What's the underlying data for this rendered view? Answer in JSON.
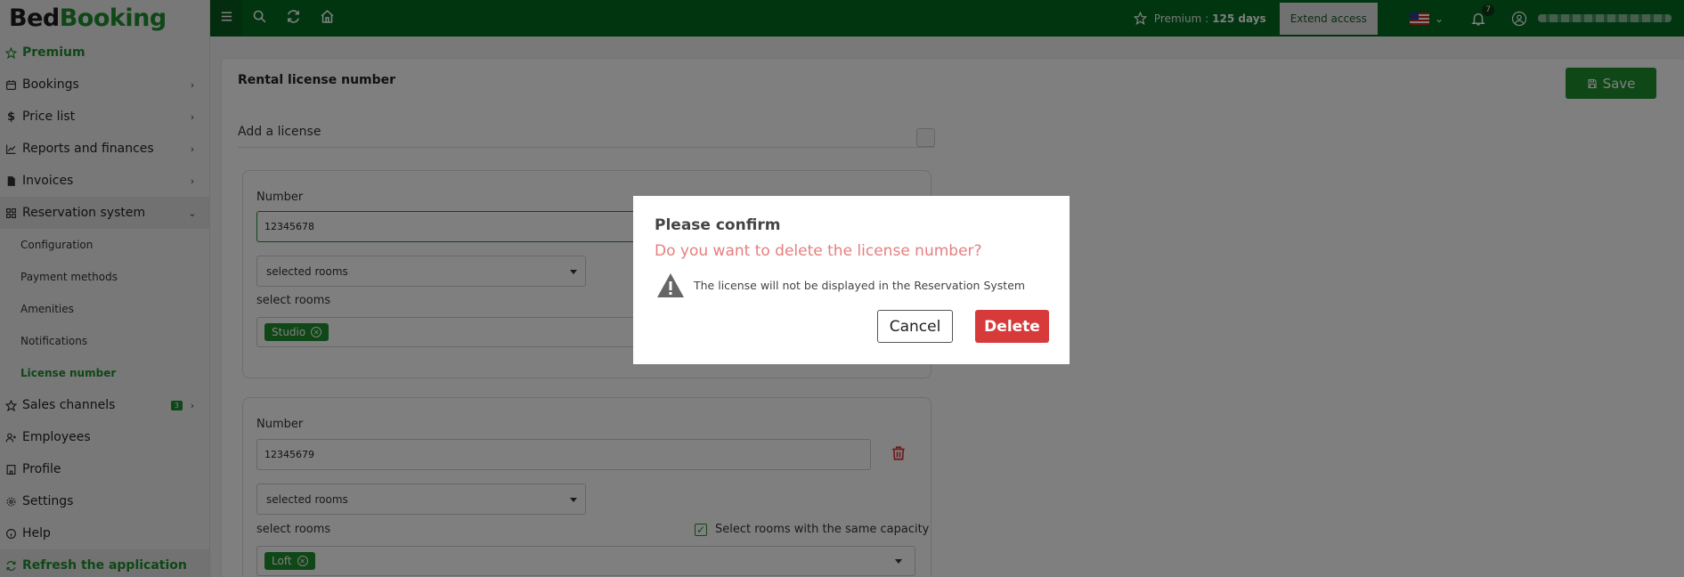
{
  "brand": {
    "part1": "Bed",
    "part2": "Booking"
  },
  "sidebar": {
    "items": [
      {
        "label": "Premium"
      },
      {
        "label": "Bookings"
      },
      {
        "label": "Price list"
      },
      {
        "label": "Reports and finances"
      },
      {
        "label": "Invoices"
      },
      {
        "label": "Reservation system"
      },
      {
        "label": "Sales channels",
        "badge": "3"
      },
      {
        "label": "Employees"
      },
      {
        "label": "Profile"
      },
      {
        "label": "Settings"
      },
      {
        "label": "Help"
      },
      {
        "label": "Refresh the application"
      }
    ],
    "sub_items": [
      {
        "label": "Configuration"
      },
      {
        "label": "Payment methods"
      },
      {
        "label": "Amenities"
      },
      {
        "label": "Notifications"
      },
      {
        "label": "License number"
      }
    ]
  },
  "topbar": {
    "premium_label": "Premium :",
    "premium_days": "125 days",
    "extend_label": "Extend access",
    "notifications_count": "7"
  },
  "main": {
    "title": "Rental license number",
    "save_label": "Save",
    "add_license_label": "Add a license",
    "licenses": [
      {
        "number_label": "Number",
        "number_value": "12345678",
        "select_value": "selected rooms",
        "rooms_label": "select rooms",
        "tag": "Studio"
      },
      {
        "number_label": "Number",
        "number_value": "12345679",
        "select_value": "selected rooms",
        "rooms_label": "select rooms",
        "same_capacity_label": "Select rooms with the same capacity",
        "tag": "Loft"
      }
    ]
  },
  "modal": {
    "title": "Please confirm",
    "question": "Do you want to delete the license number?",
    "warning": "The license will not be displayed in the Reservation System",
    "cancel_label": "Cancel",
    "delete_label": "Delete"
  },
  "colors": {
    "brand_green": "#1e8f2f",
    "topbar_green": "#006b21",
    "danger": "#d73a3a",
    "question_text": "#e57f7f"
  }
}
